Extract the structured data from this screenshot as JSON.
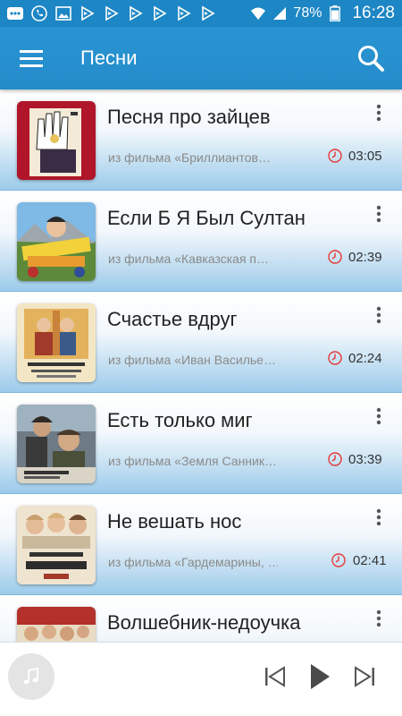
{
  "status_bar": {
    "battery": "78%",
    "time": "16:28",
    "left_icons": [
      "more-icon",
      "phone-icon",
      "gallery-icon",
      "play-store-icon",
      "play-store-icon",
      "play-store-icon",
      "play-store-icon",
      "play-store-icon",
      "play-store-icon"
    ]
  },
  "app_bar": {
    "title": "Песни"
  },
  "songs": [
    {
      "title": "Песня про зайцев",
      "subtitle": "из фильма «Бриллиантов…",
      "duration": "03:05"
    },
    {
      "title": "Если Б Я Был Султан",
      "subtitle": "из фильма «Кавказская п…",
      "duration": "02:39"
    },
    {
      "title": "Счастье вдруг",
      "subtitle": "из фильма «Иван Василье…",
      "duration": "02:24"
    },
    {
      "title": "Есть только миг",
      "subtitle": "из фильма «Земля Санник…",
      "duration": "03:39"
    },
    {
      "title": "Не вешать нос",
      "subtitle": "из фильма «Гардемарины, …",
      "duration": "02:41"
    },
    {
      "title": "Волшебник-недоучка",
      "subtitle": "",
      "duration": ""
    }
  ],
  "colors": {
    "accent": "#2a95d3",
    "clock": "#e53935"
  }
}
